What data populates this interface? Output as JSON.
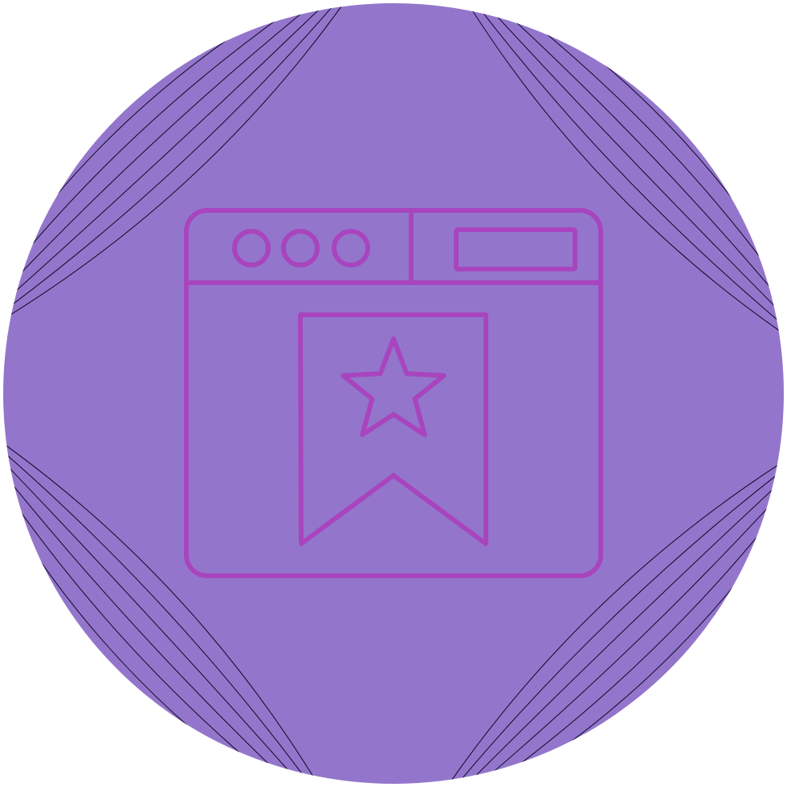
{
  "icon": {
    "name": "browser-bookmark-icon",
    "colors": {
      "badge_fill": "#9376CC",
      "stroke": "#A845BE",
      "corner_lines": "#1a1030",
      "page_background": "#FFFFFF"
    },
    "parts": [
      "badge-circle",
      "browser-window-icon",
      "window-control-dots",
      "address-bar",
      "bookmark-ribbon-icon",
      "star-icon"
    ]
  }
}
